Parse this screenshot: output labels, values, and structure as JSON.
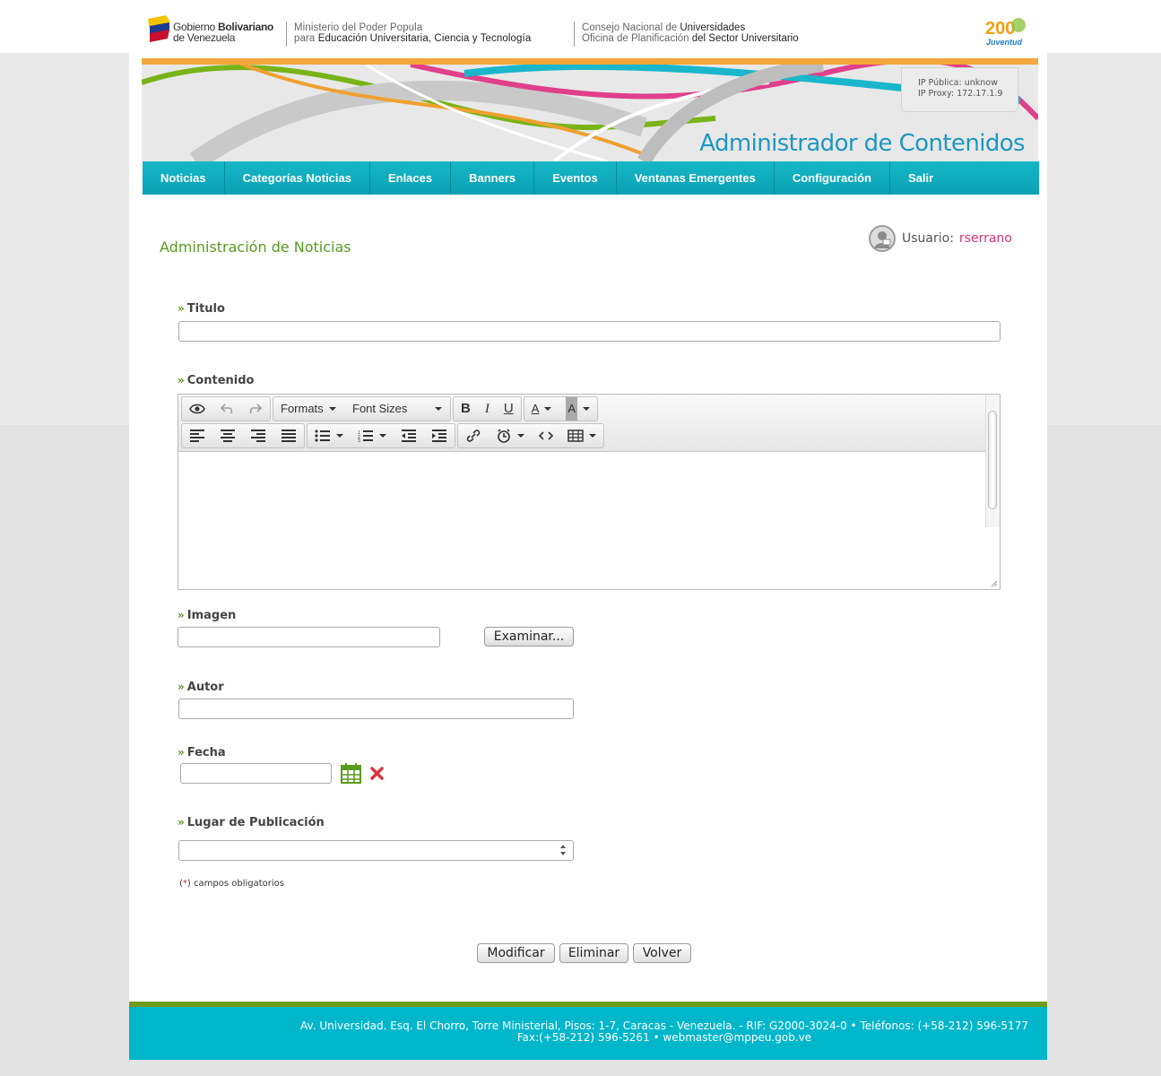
{
  "header": {
    "gov_name_1": "Gobierno",
    "gov_name_bold": "Bolivariano",
    "gov_name_2": "de Venezuela",
    "ministry_line1": "Ministerio del Poder Popula",
    "ministry_line2_prefix": "para",
    "ministry_line2_bold": "Educación Universitaria, Ciencia y Tecnología",
    "consejo_line1_prefix": "Consejo Nacional de",
    "consejo_line1_bold": "Universidades",
    "consejo_line2_prefix": "Oficina de Planificación",
    "consejo_line2_bold": "del Sector Universitario",
    "juv_logo_text": "Juventud",
    "juv_logo_number": "200"
  },
  "banner": {
    "ip_public": "IP Pública: unknow",
    "ip_proxy": "IP Proxy: 172.17.1.9",
    "title": "Administrador de Contenidos"
  },
  "nav": {
    "items": [
      "Noticias",
      "Categorías Noticias",
      "Enlaces",
      "Banners",
      "Eventos",
      "Ventanas Emergentes",
      "Configuración",
      "Salir"
    ]
  },
  "page": {
    "title": "Administración de Noticias",
    "user_label": "Usuario:",
    "user_name": "rserrano"
  },
  "form": {
    "titulo_label": "Titulo",
    "titulo_value": "",
    "contenido_label": "Contenido",
    "editor_formats": "Formats",
    "editor_font_sizes": "Font Sizes",
    "editor_bold": "B",
    "editor_italic": "I",
    "editor_underline": "U",
    "editor_forecolor": "A",
    "editor_backcolor": "A",
    "imagen_label": "Imagen",
    "imagen_value": "",
    "browse_label": "Examinar...",
    "autor_label": "Autor",
    "autor_value": "",
    "fecha_label": "Fecha",
    "fecha_value": "",
    "lugar_label": "Lugar de Publicación",
    "lugar_value": "",
    "required_mark": "*",
    "required_note": "campos obligatorios"
  },
  "actions": {
    "modify": "Modificar",
    "delete": "Eliminar",
    "back": "Volver"
  },
  "footer": {
    "line1": "Av. Universidad. Esq. El Chorro, Torre Ministerial, Pisos: 1-7, Caracas - Venezuela. - RIF: G2000-3024-0  • Teléfonos: (+58-212) 596-5177",
    "line2": "Fax:(+58-212) 596-5261 • webmaster@mppeu.gob.ve"
  },
  "colors": {
    "accent_green": "#5a9a1e",
    "nav_teal": "#0aa1b3",
    "user_pink": "#d6347a",
    "footer_teal": "#00b6cb",
    "banner_orange": "#f3a63c"
  }
}
